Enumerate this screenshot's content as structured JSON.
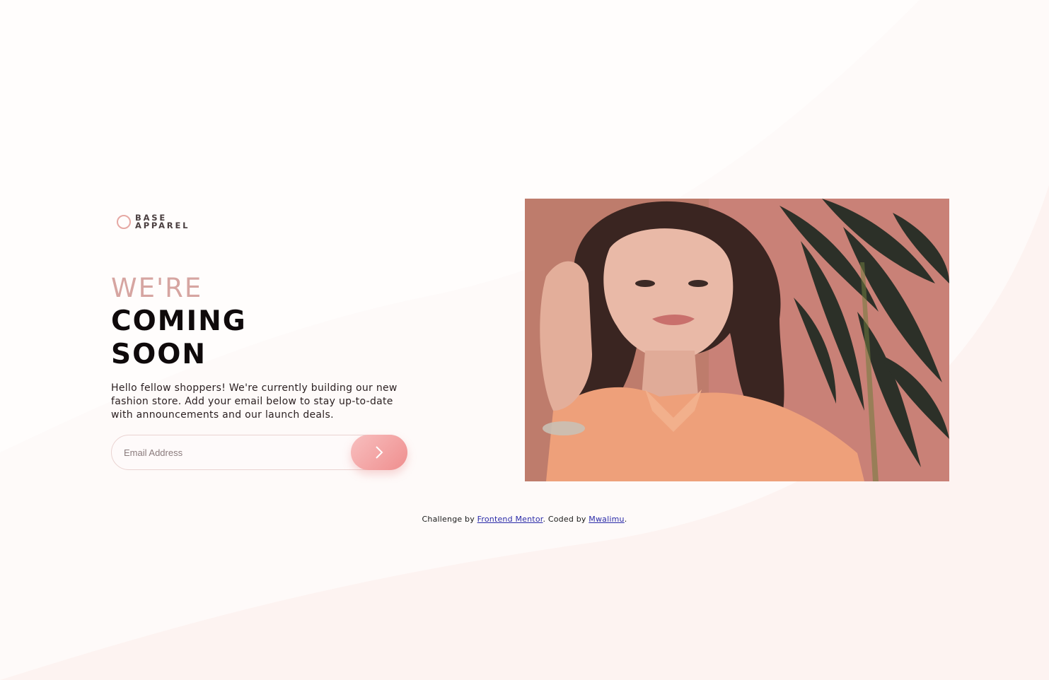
{
  "brand": {
    "line1": "BASE",
    "line2": "APPAREL"
  },
  "headline": {
    "light": "WE'RE",
    "dark_line1": "COMING",
    "dark_line2": "SOON"
  },
  "intro": "Hello fellow shoppers! We're currently building our new fashion store. Add your email below to stay up-to-date with announcements and our launch deals.",
  "form": {
    "placeholder": "Email Address",
    "value": ""
  },
  "hero": {
    "icon": "woman-portrait-photo"
  },
  "footer": {
    "prefix": "Challenge by",
    "link1": "Frontend Mentor",
    "middle": ". Coded by",
    "link2": "Mwalimu",
    "suffix": "."
  },
  "colors": {
    "accent": "#ef8e8e",
    "accent_light": "#f8bfbf",
    "heading_light": "#d6a5a1",
    "heading_dark": "#0f0a0b",
    "background": "#fdf3f1"
  }
}
